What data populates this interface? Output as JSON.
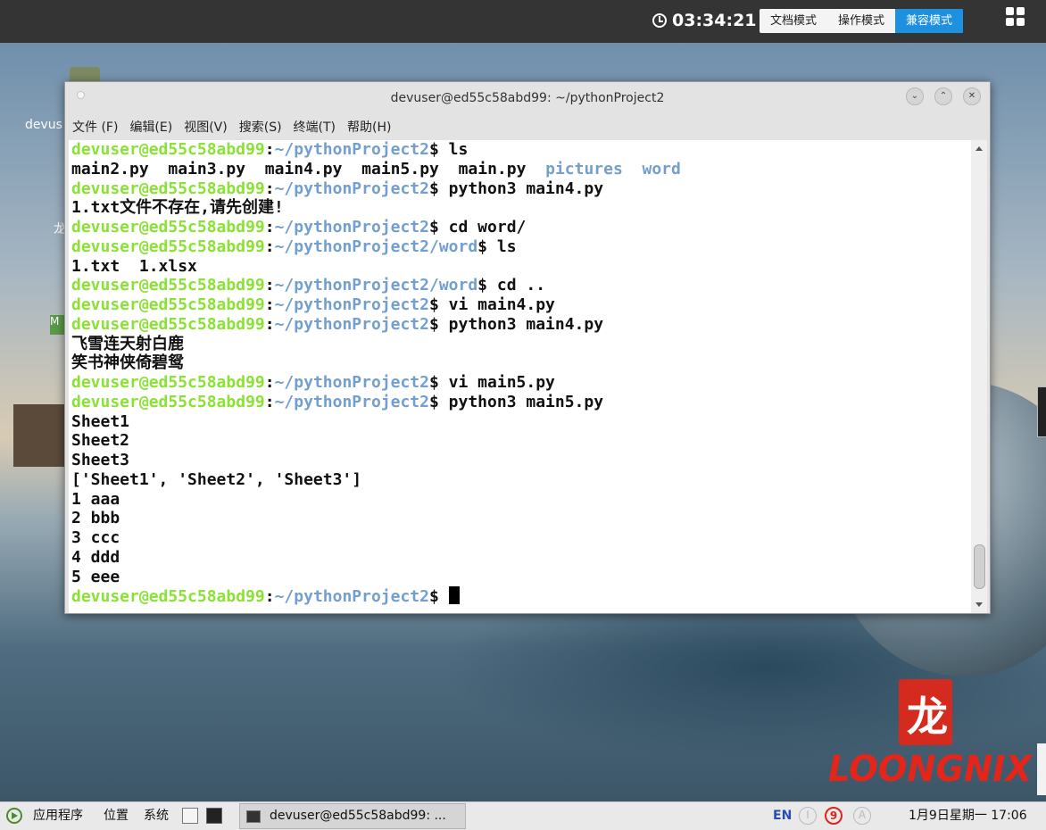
{
  "remote_bar": {
    "timer": "03:34:21",
    "modes": [
      "文档模式",
      "操作模式",
      "兼容模式"
    ],
    "active_mode": "兼容模式"
  },
  "desktop": {
    "icon_label": "devus",
    "side_char": "龙",
    "side_badge": "M",
    "logo_text": "LOONGNIX",
    "logo_glyph": "龙"
  },
  "terminal": {
    "title": "devuser@ed55c58abd99: ~/pythonProject2",
    "menu": [
      "文件 (F)",
      "编辑(E)",
      "视图(V)",
      "搜索(S)",
      "终端(T)",
      "帮助(H)"
    ],
    "user_host": "devuser@ed55c58abd99",
    "lines": [
      {
        "type": "prompt",
        "path": "~/pythonProject2",
        "cmd": "ls"
      },
      {
        "type": "ls",
        "files": [
          "main2.py",
          "main3.py",
          "main4.py",
          "main5.py",
          "main.py"
        ],
        "dirs": [
          "pictures",
          "word"
        ]
      },
      {
        "type": "prompt",
        "path": "~/pythonProject2",
        "cmd": "python3 main4.py"
      },
      {
        "type": "out",
        "text": "1.txt文件不存在,请先创建!"
      },
      {
        "type": "prompt",
        "path": "~/pythonProject2",
        "cmd": "cd word/"
      },
      {
        "type": "prompt",
        "path": "~/pythonProject2/word",
        "cmd": "ls"
      },
      {
        "type": "out",
        "text": "1.txt  1.xlsx"
      },
      {
        "type": "prompt",
        "path": "~/pythonProject2/word",
        "cmd": "cd .."
      },
      {
        "type": "prompt",
        "path": "~/pythonProject2",
        "cmd": "vi main4.py"
      },
      {
        "type": "prompt",
        "path": "~/pythonProject2",
        "cmd": "python3 main4.py"
      },
      {
        "type": "out",
        "text": "飞雪连天射白鹿"
      },
      {
        "type": "out",
        "text": "笑书神侠倚碧鸳"
      },
      {
        "type": "prompt",
        "path": "~/pythonProject2",
        "cmd": "vi main5.py"
      },
      {
        "type": "prompt",
        "path": "~/pythonProject2",
        "cmd": "python3 main5.py"
      },
      {
        "type": "out",
        "text": "Sheet1"
      },
      {
        "type": "out",
        "text": "Sheet2"
      },
      {
        "type": "out",
        "text": "Sheet3"
      },
      {
        "type": "out",
        "text": "['Sheet1', 'Sheet2', 'Sheet3']"
      },
      {
        "type": "out",
        "text": "1 aaa"
      },
      {
        "type": "out",
        "text": "2 bbb"
      },
      {
        "type": "out",
        "text": "3 ccc"
      },
      {
        "type": "out",
        "text": "4 ddd"
      },
      {
        "type": "out",
        "text": "5 eee"
      },
      {
        "type": "prompt",
        "path": "~/pythonProject2",
        "cmd": "",
        "cursor": true
      }
    ]
  },
  "panel": {
    "apps": "应用程序",
    "places": "位置",
    "system": "系统",
    "task_label": "devuser@ed55c58abd99: ...",
    "ime_lang": "EN",
    "ime_icons": [
      "I",
      "9",
      "A"
    ],
    "clock": "1月9日星期一 17:06"
  },
  "colors": {
    "prompt_user": "#8ae234",
    "prompt_path": "#729fcf",
    "dir": "#729fcf",
    "accent": "#1e90e0",
    "logo": "#e3251a"
  }
}
